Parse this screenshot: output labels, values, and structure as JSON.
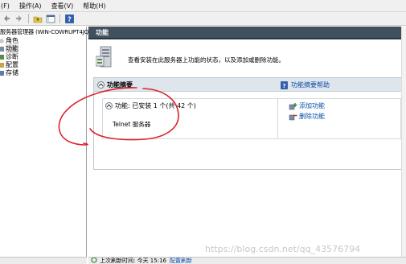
{
  "menubar": {
    "items": [
      "(F)",
      "操作(A)",
      "查看(V)",
      "帮助(H)"
    ]
  },
  "tree": {
    "root": "服务器管理器 (WIN-COWRUPT4JQ",
    "items": [
      {
        "label": "角色"
      },
      {
        "label": "功能"
      },
      {
        "label": "诊断"
      },
      {
        "label": "配置"
      },
      {
        "label": "存储"
      }
    ]
  },
  "main": {
    "title": "功能",
    "intro": "查看安装在此服务器上功能的状态，以及添加或删除功能。",
    "summary": {
      "title": "功能摘要",
      "help_link": "功能摘要帮助",
      "features_status": "功能: 已安装 1 个(共 42 个)",
      "installed_feature": "Telnet 服务器",
      "add_link": "添加功能",
      "remove_link": "删除功能"
    }
  },
  "statusbar": {
    "text": "上次刷新时间: 今天 15:16",
    "link": "配置刷新"
  },
  "watermark": "https://blog.csdn.net/qq_43576794",
  "colors": {
    "title_bar": "#41505f",
    "section_head": "#dfe5ec",
    "link": "#0a4fa8",
    "annotation": "#e0202a"
  }
}
